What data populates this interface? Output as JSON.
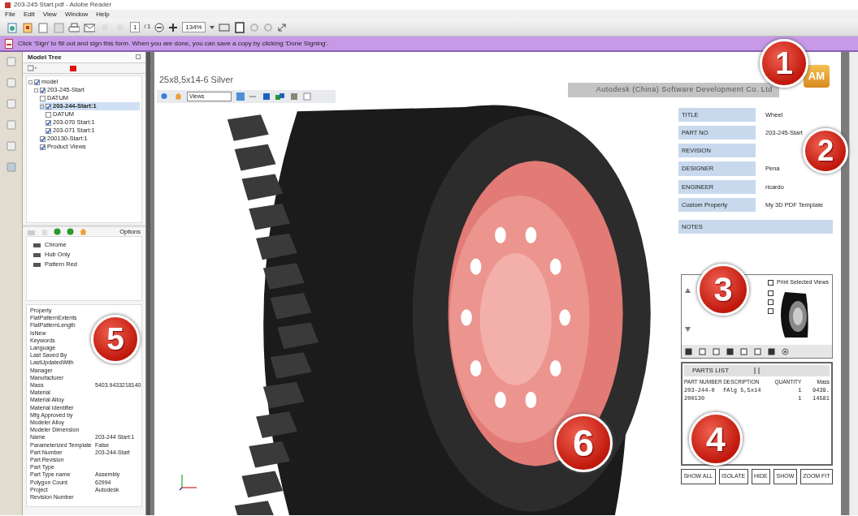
{
  "window": {
    "title": "203-245 Start.pdf - Adobe Reader"
  },
  "menu": [
    "File",
    "Edit",
    "View",
    "Window",
    "Help"
  ],
  "toolbar": {
    "page": "1",
    "page_total": "/ 1",
    "zoom": "134%"
  },
  "message_bar": {
    "text": "Click 'Sign' to fill out and sign this form. When you are done, you can save a copy by clicking 'Done Signing'."
  },
  "model_tree": {
    "title": "Model Tree",
    "items": [
      {
        "label": "model",
        "checked": true,
        "selected": false,
        "children": [
          {
            "label": "203-245-Start",
            "checked": true,
            "selected": false,
            "children": [
              {
                "label": "DATUM",
                "checked": false,
                "selected": false
              },
              {
                "label": "203-244-Start:1",
                "checked": true,
                "selected": true,
                "children": [
                  {
                    "label": "DATUM",
                    "checked": false,
                    "selected": false
                  },
                  {
                    "label": "203-070 Start:1",
                    "checked": true,
                    "selected": false
                  },
                  {
                    "label": "203-071 Start:1",
                    "checked": true,
                    "selected": false
                  }
                ]
              },
              {
                "label": "200130-Start:1",
                "checked": true,
                "selected": false
              },
              {
                "label": "Product Views",
                "checked": true,
                "selected": false
              }
            ]
          }
        ]
      }
    ],
    "views_options": "Options",
    "views": [
      {
        "label": "Chrome"
      },
      {
        "label": "Hub Only"
      },
      {
        "label": "Pattern Red"
      }
    ],
    "properties": [
      {
        "name": "Property"
      },
      {
        "name": "FlatPatternExtents"
      },
      {
        "name": "FlatPatternLength"
      },
      {
        "name": "IsNew"
      },
      {
        "name": "Keywords"
      },
      {
        "name": "Language"
      },
      {
        "name": "Last Saved By"
      },
      {
        "name": "LastUpdatedWith"
      },
      {
        "name": "Manager"
      },
      {
        "name": "Manufacturer"
      },
      {
        "name": "Mass",
        "value": "5403.9433218140"
      },
      {
        "name": "Material"
      },
      {
        "name": "Material Alloy"
      },
      {
        "name": "Material Identifier"
      },
      {
        "name": "Mfg Approved by"
      },
      {
        "name": "Modeler Alloy"
      },
      {
        "name": "Modeler Dimension"
      },
      {
        "name": "Name",
        "value": "203-244 Start:1"
      },
      {
        "name": "Parameterized Template",
        "value": "False"
      },
      {
        "name": "Part Number",
        "value": "203-244-Start"
      },
      {
        "name": "Part Revision"
      },
      {
        "name": "Part Type"
      },
      {
        "name": "Part Type name",
        "value": "Assembly"
      },
      {
        "name": "Polygon Count",
        "value": "62994"
      },
      {
        "name": "Project",
        "value": "Autodesk"
      },
      {
        "name": "Revision Number"
      }
    ]
  },
  "document": {
    "title": "25x8,5x14-6 Silver",
    "view_select": "Views",
    "company": "Autodesk (China) Software Development Co. Ltd",
    "logo": "AM",
    "title_block": [
      {
        "label": "TITLE",
        "value": "Wheel"
      },
      {
        "label": "PART NO",
        "value": "203-245-Start"
      },
      {
        "label": "REVISION"
      },
      {
        "label": "DESIGNER",
        "value": "Pena"
      },
      {
        "label": "ENGINEER",
        "value": "ricardo"
      },
      {
        "label": "Custom Property",
        "value": "My 3D PDF Template"
      }
    ],
    "notes_label": "NOTES",
    "views_panel": {
      "print_label": "Print Selected Views",
      "print_checked": false,
      "view_checks": [
        false,
        false,
        false
      ]
    },
    "parts_list": {
      "title": "PARTS LIST",
      "columns": [
        "PART NUMBER",
        "DESCRIPTION",
        "QUANTITY",
        "Mass"
      ],
      "rows": [
        [
          "203-244-0",
          "FAlg 5,5x14",
          "1",
          "9439."
        ],
        [
          "200130",
          "",
          "1",
          "14581"
        ]
      ]
    },
    "buttons": [
      "SHOW ALL",
      "ISOLATE",
      "HIDE",
      "SHOW",
      "ZOOM FIT"
    ]
  },
  "callouts": [
    "1",
    "2",
    "3",
    "4",
    "5",
    "6"
  ]
}
